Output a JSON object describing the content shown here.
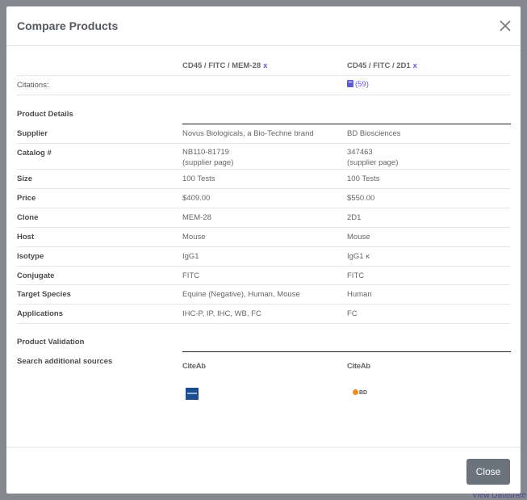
{
  "modal": {
    "title": "Compare Products",
    "close_label": "Close"
  },
  "products": [
    {
      "name": "CD45 / FITC / MEM-28",
      "remove": "x"
    },
    {
      "name": "CD45 / FITC / 2D1",
      "remove": "x"
    }
  ],
  "citations": {
    "label": "Citations:",
    "p2_count": "(59)"
  },
  "sections": {
    "details": "Product Details",
    "validation": "Product Validation",
    "search": "Search additional sources"
  },
  "rows": {
    "supplier": {
      "label": "Supplier",
      "p1": "Novus Biologicals, a Bio-Techne brand",
      "p2": "BD Biosciences"
    },
    "catalog": {
      "label": "Catalog #",
      "p1": "NB110-81719",
      "p2": "347463",
      "link": "(supplier page)"
    },
    "size": {
      "label": "Size",
      "p1": "100 Tests",
      "p2": "100 Tests"
    },
    "price": {
      "label": "Price",
      "p1": "$409.00",
      "p2": "$550.00"
    },
    "clone": {
      "label": "Clone",
      "p1": "MEM-28",
      "p2": "2D1"
    },
    "host": {
      "label": "Host",
      "p1": "Mouse",
      "p2": "Mouse"
    },
    "isotype": {
      "label": "Isotype",
      "p1": "IgG1",
      "p2": "IgG1 κ"
    },
    "conjugate": {
      "label": "Conjugate",
      "p1": "FITC",
      "p2": "FITC"
    },
    "species": {
      "label": "Target Species",
      "p1": "Equine (Negative), Human, Mouse",
      "p2": "Human"
    },
    "applications": {
      "label": "Applications",
      "p1": "IHC-P, IP, IHC, WB, FC",
      "p2": "FC"
    }
  },
  "sources": {
    "citeab": "CiteAb",
    "bd": "BD"
  },
  "background": {
    "frag_bottom": "View Datashee"
  },
  "colors": {
    "link": "#5b5bd6",
    "button": "#6b747c",
    "citeab": "#1f8fc5"
  }
}
